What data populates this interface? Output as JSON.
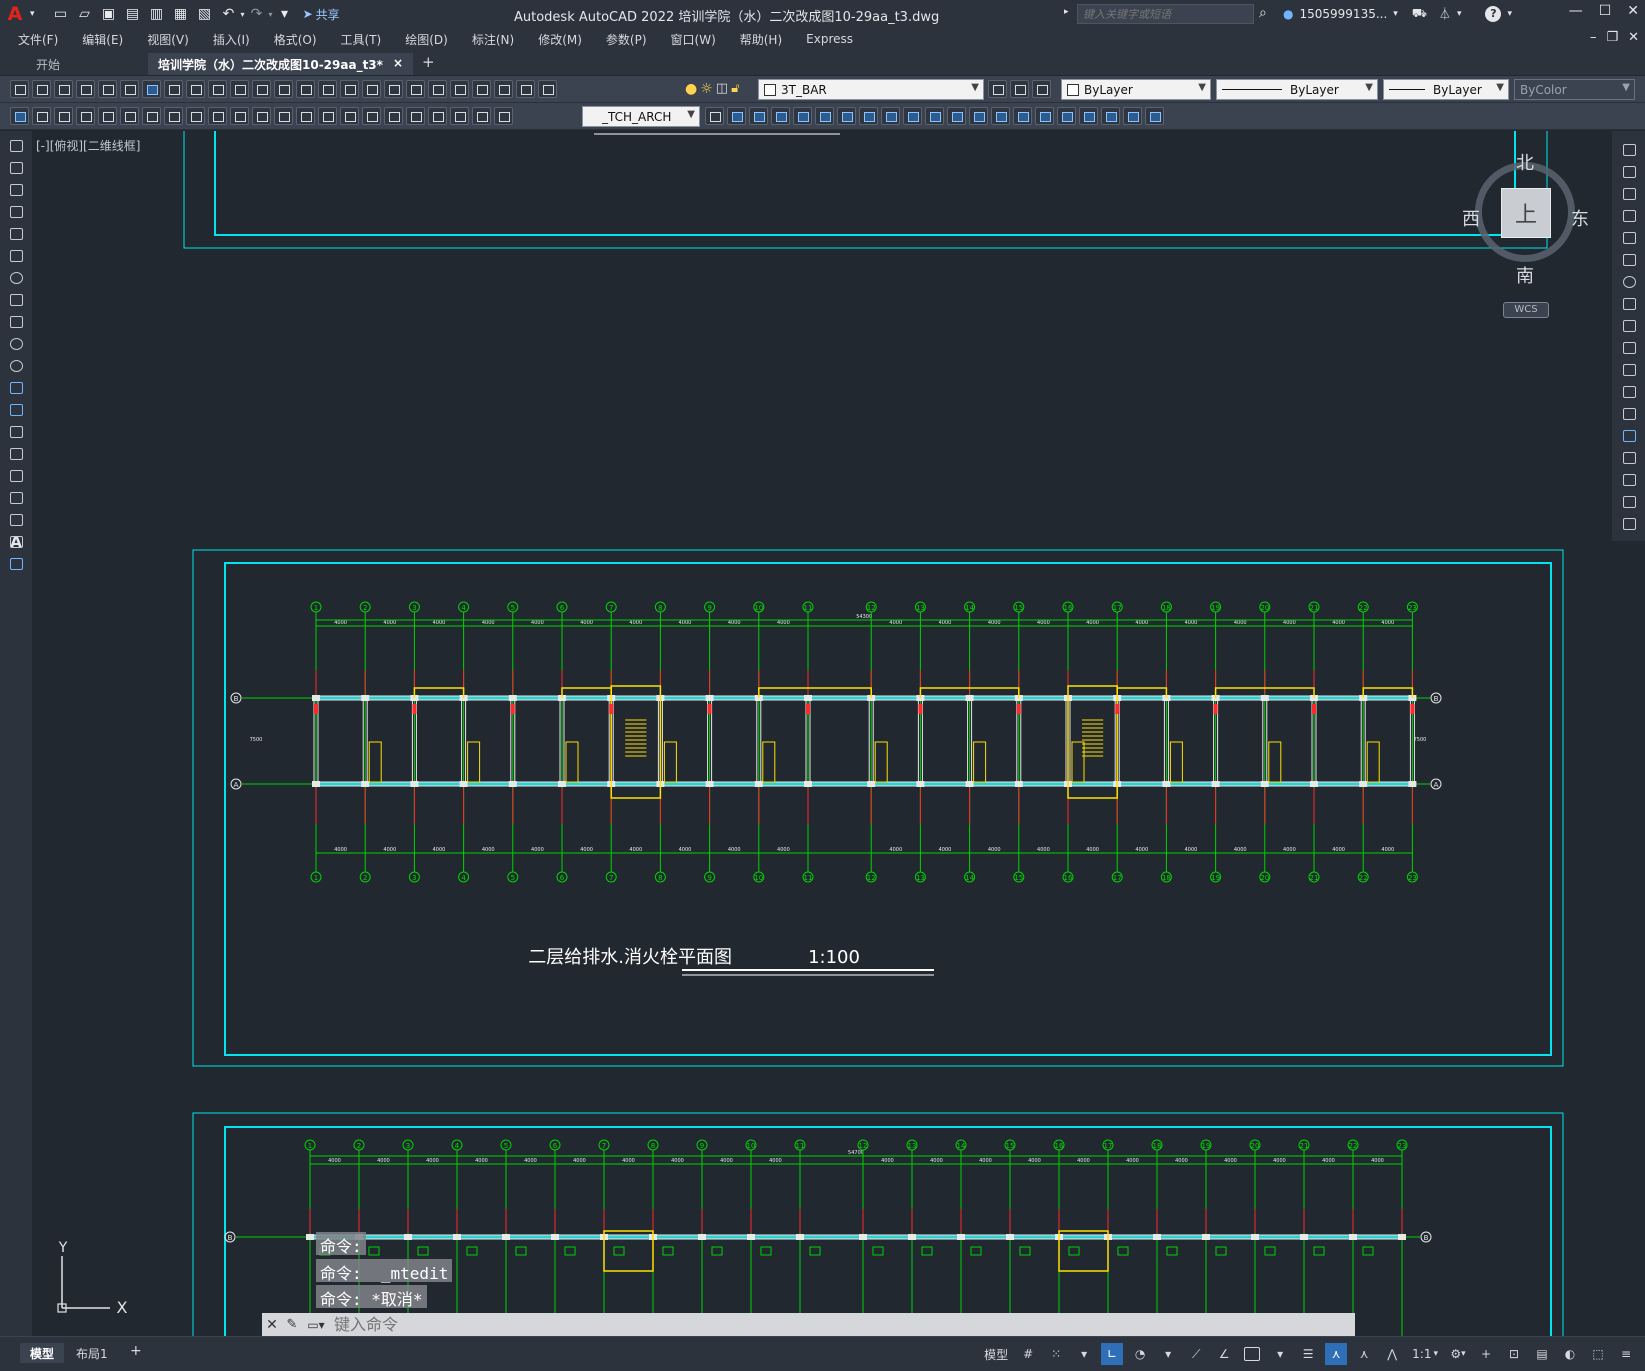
{
  "app": {
    "logo": "A",
    "title": "Autodesk AutoCAD 2022    培训学院（水）二次改成图10-29aa_t3.dwg",
    "share_label": "共享",
    "search_placeholder": "键入关键字或短语",
    "user_name": "1505999135...",
    "icons": [
      "search-icon",
      "user-icon",
      "cart-icon",
      "autodesk-account-icon",
      "help-icon"
    ]
  },
  "menu": {
    "items": [
      "文件(F)",
      "编辑(E)",
      "视图(V)",
      "插入(I)",
      "格式(O)",
      "工具(T)",
      "绘图(D)",
      "标注(N)",
      "修改(M)",
      "参数(P)",
      "窗口(W)",
      "帮助(H)",
      "Express"
    ]
  },
  "tabs": {
    "start": "开始",
    "active": "培训学院（水）二次改成图10-29aa_t3*",
    "close": "×",
    "add": "+"
  },
  "toolbar": {
    "layer_combo": "3T_BAR",
    "color_combo": "ByLayer",
    "linetype_combo": "ByLayer",
    "lineweight_combo": "ByLayer",
    "plotstyle_combo": "ByColor",
    "textstyle_combo": "_TCH_ARCH"
  },
  "viewport": {
    "label": "[-][俯视][二维线框]"
  },
  "viewcube": {
    "north": "北",
    "south": "南",
    "east": "东",
    "west": "西",
    "top": "上",
    "wcs": "WCS"
  },
  "drawing": {
    "plan_title": "二层给排水.消火栓平面图",
    "plan_scale": "1:100",
    "total_dim": "54300",
    "total_dim_lower": "54700",
    "bay_dim": "4000",
    "axis_labels": [
      "1",
      "2",
      "3",
      "4",
      "5",
      "6",
      "7",
      "8",
      "9",
      "10",
      "11",
      "12",
      "13",
      "14",
      "15",
      "16",
      "17",
      "18",
      "19",
      "20",
      "21",
      "22",
      "23"
    ],
    "row_labels": [
      "B",
      "A"
    ],
    "colors": {
      "frame": "#00e5ee",
      "grid": "#00d400",
      "wall": "#e8e8e8",
      "pipe": "#2fd0d0",
      "stair": "#ffe000",
      "red": "#ff2a2a",
      "title": "#ffffff"
    }
  },
  "ucs": {
    "x": "X",
    "y": "Y"
  },
  "command": {
    "history": [
      "命令:",
      "命令:  _mtedit",
      "命令: *取消*"
    ],
    "placeholder": "键入命令"
  },
  "status": {
    "model_tab": "模型",
    "layout_tab": "布局1",
    "add_tab": "+",
    "model_label": "模型",
    "scale": "1:1",
    "buttons_on": [
      "ortho",
      "annotation-visibility"
    ]
  }
}
